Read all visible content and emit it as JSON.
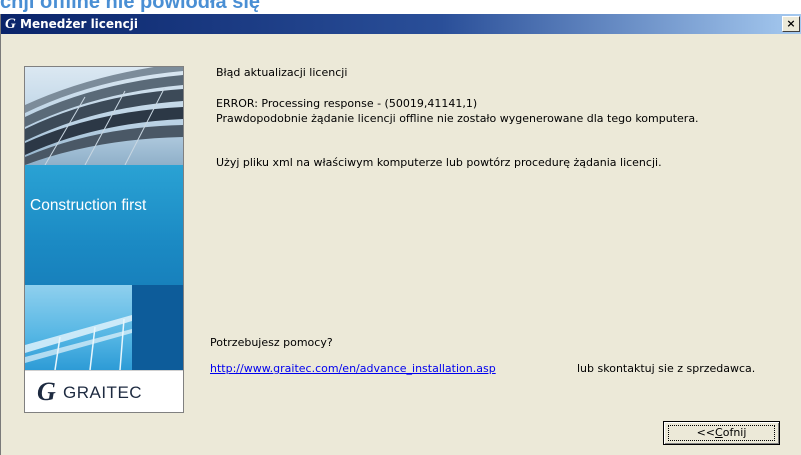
{
  "page_heading": "cnji offline nie powiodła się",
  "window": {
    "title": "Menedżer licencji",
    "logo_glyph": "G",
    "close_glyph": "×",
    "close_icon": "close-icon"
  },
  "sidebar": {
    "tagline": "Construction first",
    "brand_glyph": "G",
    "brand_name": "GRAITEC",
    "colors": {
      "blue": "#1b8ac4",
      "dark_blue": "#0d5c9a",
      "light_blue": "#8fd0ee"
    }
  },
  "message": {
    "title": "Błąd aktualizacji licencji",
    "error": "ERROR: Processing response - (50019,41141,1)",
    "explanation": "Prawdopodobnie żądanie licencji offline nie zostało wygenerowane dla tego komputera.",
    "hint": "Użyj pliku xml na właściwym komputerze lub powtórz procedurę żądania licencji."
  },
  "help": {
    "title": "Potrzebujesz pomocy?",
    "link": "http://www.graitec.com/en/advance_installation.asp",
    "contact": "lub skontaktuj sie z sprzedawca."
  },
  "buttons": {
    "back_prefix": "<<",
    "back_accel": "C",
    "back_rest": "ofnij"
  }
}
